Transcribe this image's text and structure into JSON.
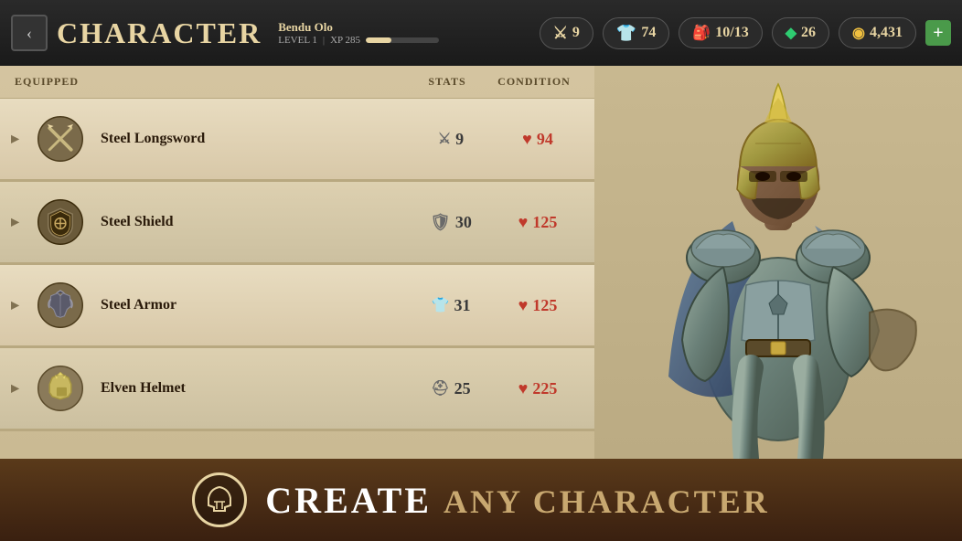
{
  "header": {
    "back_label": "‹",
    "title": "CHARACTER",
    "char_name": "Bendu Olo",
    "level_label": "LEVEL 1",
    "xp_label": "XP 285",
    "xp_percent": 35,
    "attack_label": "9",
    "armor_label": "74",
    "inventory_label": "10/13",
    "gems_label": "26",
    "gold_label": "4,431",
    "plus_label": "+"
  },
  "columns": {
    "equipped": "EQUIPPED",
    "stats": "STATS",
    "condition": "CONDITION"
  },
  "items": [
    {
      "name": "Steel Longsword",
      "stat_icon": "⚔",
      "stat_value": "9",
      "condition_value": "94",
      "icon_type": "sword"
    },
    {
      "name": "Steel Shield",
      "stat_icon": "🛡",
      "stat_value": "30",
      "condition_value": "125",
      "icon_type": "shield"
    },
    {
      "name": "Steel Armor",
      "stat_icon": "👕",
      "stat_value": "31",
      "condition_value": "125",
      "icon_type": "armor"
    },
    {
      "name": "Elven Helmet",
      "stat_icon": "⛑",
      "stat_value": "25",
      "condition_value": "225",
      "icon_type": "helm"
    }
  ],
  "banner": {
    "text_highlight": "CREATE",
    "text_normal": "any character"
  },
  "colors": {
    "bg_dark": "#1a1a1a",
    "bg_parchment": "#d4c4a0",
    "accent_gold": "#e8d5a3",
    "text_dark": "#2a1a0a",
    "health_red": "#c0392b",
    "banner_bg": "#3a2010"
  }
}
